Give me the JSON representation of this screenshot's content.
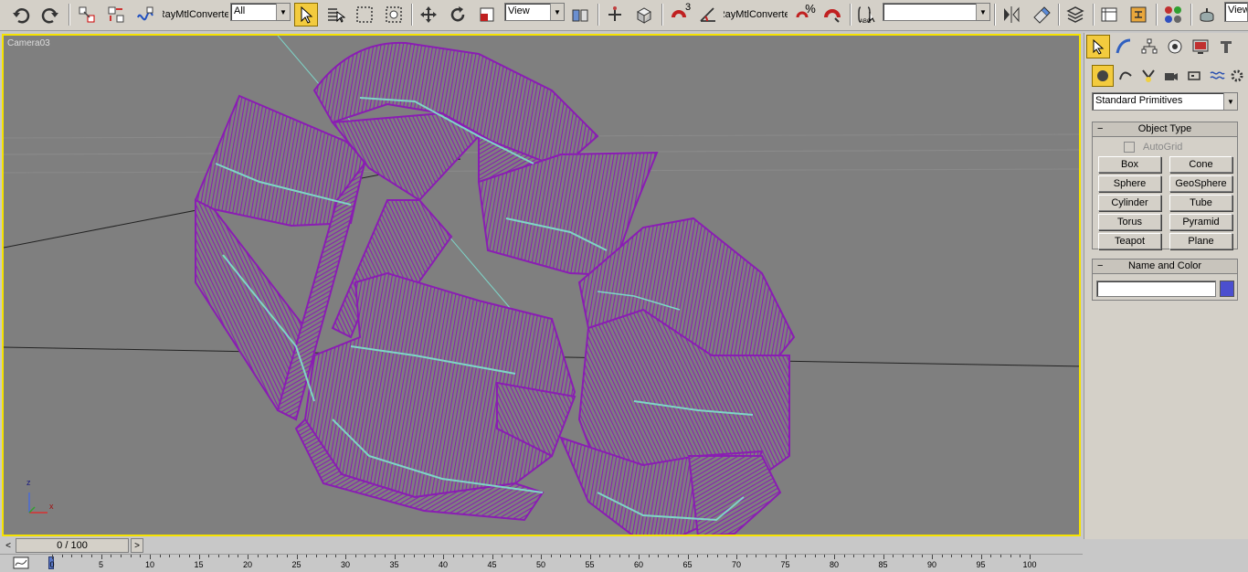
{
  "toolbar": {
    "raymtl_converter_label": "RayMtlConverter",
    "selection_filter": "All",
    "reference_coord": "View",
    "snap_label": "3",
    "percent_snap_label": "%",
    "raymtl_converter_label_2": "RayMtlConverter",
    "named_selection": "",
    "view_cut_label": "View",
    "abc_label": "ABC"
  },
  "viewport": {
    "label": "Camera03",
    "axis_x": "x",
    "axis_z": "z",
    "colors": {
      "wire": "#8a1db3",
      "spline": "#7fd4c8",
      "background": "#7f7f7f",
      "border": "#f6e300"
    }
  },
  "command_panel": {
    "category_dropdown": "Standard Primitives",
    "object_type": {
      "title": "Object Type",
      "autogrid": "AutoGrid",
      "buttons": [
        "Box",
        "Cone",
        "Sphere",
        "GeoSphere",
        "Cylinder",
        "Tube",
        "Torus",
        "Pyramid",
        "Teapot",
        "Plane"
      ]
    },
    "name_and_color": {
      "title": "Name and Color",
      "name_value": "",
      "swatch_color": "#4b4fcf"
    },
    "collapse_symbol": "−"
  },
  "time": {
    "slider_label": "0 / 100",
    "next_symbol": ">",
    "prev_symbol": "<",
    "ticks": [
      "0",
      "5",
      "10",
      "15",
      "20",
      "25",
      "30",
      "35",
      "40",
      "45",
      "50",
      "55",
      "60",
      "65",
      "70",
      "75",
      "80",
      "85",
      "90",
      "95",
      "100"
    ]
  }
}
